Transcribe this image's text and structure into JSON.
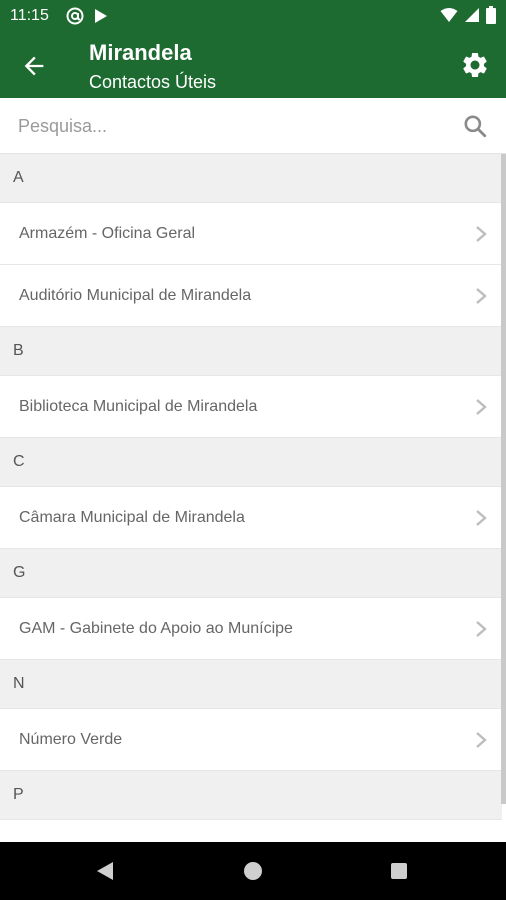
{
  "status_bar": {
    "time": "11:15",
    "left_icons": [
      "at-sign-icon",
      "play-store-icon"
    ],
    "right_icons": [
      "wifi-icon",
      "signal-icon",
      "battery-icon"
    ]
  },
  "app_bar": {
    "title": "Mirandela",
    "subtitle": "Contactos Úteis",
    "back_icon": "arrow-left-icon",
    "settings_icon": "gear-icon",
    "color": "#1e6b32"
  },
  "search": {
    "placeholder": "Pesquisa...",
    "value": ""
  },
  "sections": [
    {
      "letter": "A",
      "items": [
        "Armazém - Oficina Geral",
        "Auditório Municipal de Mirandela"
      ]
    },
    {
      "letter": "B",
      "items": [
        "Biblioteca Municipal de Mirandela"
      ]
    },
    {
      "letter": "C",
      "items": [
        "Câmara Municipal de Mirandela"
      ]
    },
    {
      "letter": "G",
      "items": [
        "GAM - Gabinete do Apoio ao Munícipe"
      ]
    },
    {
      "letter": "N",
      "items": [
        "Número Verde"
      ]
    },
    {
      "letter": "P",
      "items": [
        ""
      ]
    }
  ],
  "nav_bar": {
    "icons": [
      "nav-back-icon",
      "nav-home-icon",
      "nav-recents-icon"
    ]
  }
}
